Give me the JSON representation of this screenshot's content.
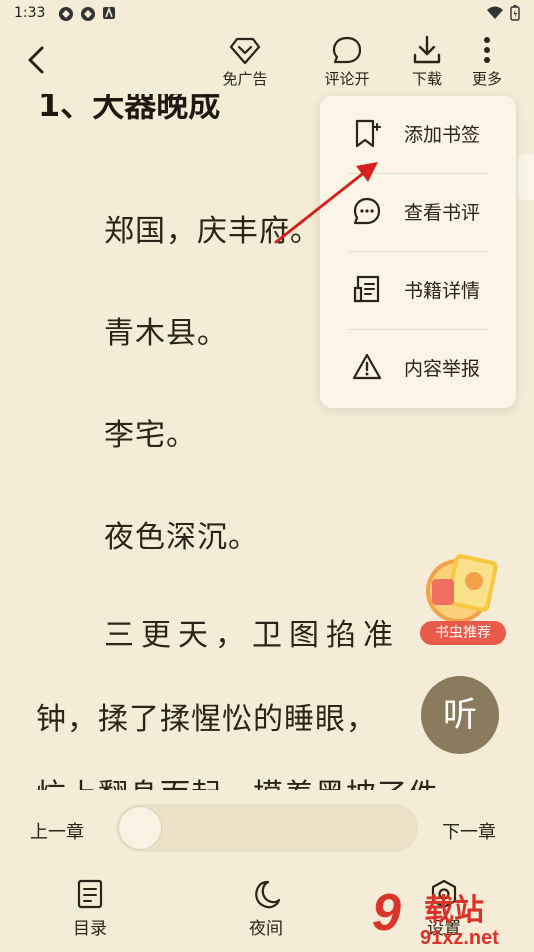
{
  "status_bar": {
    "time": "1:33"
  },
  "toolbar": {
    "ad_free_label": "免广告",
    "comments_label": "评论开",
    "download_label": "下载",
    "more_label": "更多"
  },
  "reader": {
    "chapter_title": "1、大器晚成",
    "paragraphs": [
      "郑国，庆丰府。",
      "青木县。",
      "李宅。",
      "夜色深沉。",
      "三更天，卫图掐准",
      "钟，揉了揉惺忪的睡眼，",
      "炕上翻身而起，摸着黑披了件"
    ]
  },
  "more_menu": {
    "items": [
      {
        "label": "添加书签",
        "icon": "bookmark-add-icon"
      },
      {
        "label": "查看书评",
        "icon": "comment-dots-icon"
      },
      {
        "label": "书籍详情",
        "icon": "book-details-icon"
      },
      {
        "label": "内容举报",
        "icon": "warning-icon"
      }
    ]
  },
  "promo": {
    "badge": "书虫推荐"
  },
  "listen": {
    "label": "听"
  },
  "bottom_bar": {
    "prev_chapter": "上一章",
    "next_chapter": "下一章",
    "progress": 0,
    "nav": {
      "toc": "目录",
      "night": "夜间",
      "settings": "设置"
    }
  },
  "watermark": {
    "brand": "9 载站",
    "domain": "91xz.net"
  },
  "colors": {
    "background": "#f4ecd6",
    "menu_bg": "#faf5e6",
    "text": "#2b2418",
    "listen_button": "#8a7a5e",
    "promo_badge": "#e85a4a",
    "arrow": "#d62020"
  }
}
